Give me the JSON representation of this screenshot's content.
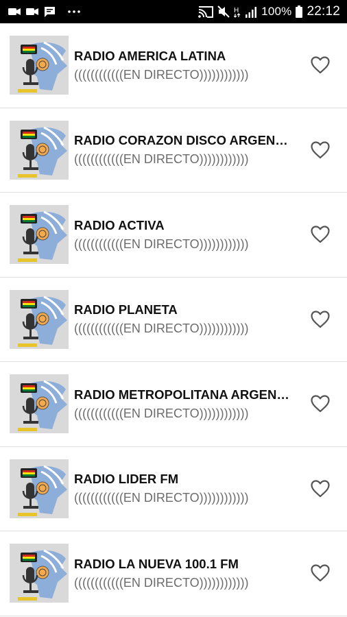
{
  "status_bar": {
    "battery": "100%",
    "time": "22:12",
    "left_icons": [
      "video-icon",
      "video-call-icon",
      "message-icon",
      "more-dots-icon"
    ],
    "right_icons": [
      "cast-icon",
      "mute-icon",
      "network-h-icon",
      "signal-icon",
      "battery-icon"
    ]
  },
  "colors": {
    "title": "#111111",
    "subtitle": "#6b6b6b",
    "divider": "#e0e0e0",
    "status_bar_bg": "#000000"
  },
  "stations": [
    {
      "name": "RADIO AMERICA LATINA",
      "subtitle": "((((((((((((EN DIRECTO))))))))))))"
    },
    {
      "name": "RADIO CORAZON DISCO ARGENTINA",
      "subtitle": "((((((((((((EN DIRECTO))))))))))))"
    },
    {
      "name": "RADIO ACTIVA",
      "subtitle": "((((((((((((EN DIRECTO))))))))))))"
    },
    {
      "name": "RADIO PLANETA",
      "subtitle": "((((((((((((EN DIRECTO))))))))))))"
    },
    {
      "name": "RADIO METROPOLITANA ARGENTINA",
      "subtitle": "((((((((((((EN DIRECTO))))))))))))"
    },
    {
      "name": "RADIO LIDER FM",
      "subtitle": "((((((((((((EN DIRECTO))))))))))))"
    },
    {
      "name": "RADIO LA NUEVA 100.1 FM",
      "subtitle": "((((((((((((EN DIRECTO))))))))))))"
    }
  ]
}
